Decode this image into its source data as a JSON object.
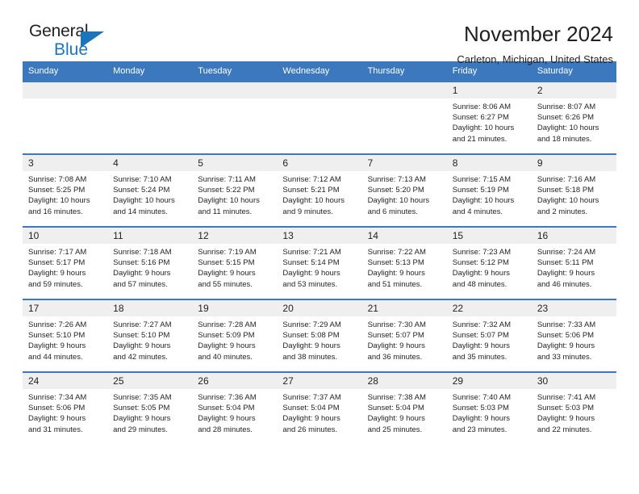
{
  "brand": {
    "name_part1": "General",
    "name_part2": "Blue",
    "accent_color": "#1b75bc",
    "header_color": "#3b78bd"
  },
  "header": {
    "title": "November 2024",
    "subtitle": "Carleton, Michigan, United States"
  },
  "calendar": {
    "weekday_headers": [
      "Sunday",
      "Monday",
      "Tuesday",
      "Wednesday",
      "Thursday",
      "Friday",
      "Saturday"
    ],
    "weeks": [
      [
        {
          "day": "",
          "lines": []
        },
        {
          "day": "",
          "lines": []
        },
        {
          "day": "",
          "lines": []
        },
        {
          "day": "",
          "lines": []
        },
        {
          "day": "",
          "lines": []
        },
        {
          "day": "1",
          "lines": [
            "Sunrise: 8:06 AM",
            "Sunset: 6:27 PM",
            "Daylight: 10 hours",
            "and 21 minutes."
          ]
        },
        {
          "day": "2",
          "lines": [
            "Sunrise: 8:07 AM",
            "Sunset: 6:26 PM",
            "Daylight: 10 hours",
            "and 18 minutes."
          ]
        }
      ],
      [
        {
          "day": "3",
          "lines": [
            "Sunrise: 7:08 AM",
            "Sunset: 5:25 PM",
            "Daylight: 10 hours",
            "and 16 minutes."
          ]
        },
        {
          "day": "4",
          "lines": [
            "Sunrise: 7:10 AM",
            "Sunset: 5:24 PM",
            "Daylight: 10 hours",
            "and 14 minutes."
          ]
        },
        {
          "day": "5",
          "lines": [
            "Sunrise: 7:11 AM",
            "Sunset: 5:22 PM",
            "Daylight: 10 hours",
            "and 11 minutes."
          ]
        },
        {
          "day": "6",
          "lines": [
            "Sunrise: 7:12 AM",
            "Sunset: 5:21 PM",
            "Daylight: 10 hours",
            "and 9 minutes."
          ]
        },
        {
          "day": "7",
          "lines": [
            "Sunrise: 7:13 AM",
            "Sunset: 5:20 PM",
            "Daylight: 10 hours",
            "and 6 minutes."
          ]
        },
        {
          "day": "8",
          "lines": [
            "Sunrise: 7:15 AM",
            "Sunset: 5:19 PM",
            "Daylight: 10 hours",
            "and 4 minutes."
          ]
        },
        {
          "day": "9",
          "lines": [
            "Sunrise: 7:16 AM",
            "Sunset: 5:18 PM",
            "Daylight: 10 hours",
            "and 2 minutes."
          ]
        }
      ],
      [
        {
          "day": "10",
          "lines": [
            "Sunrise: 7:17 AM",
            "Sunset: 5:17 PM",
            "Daylight: 9 hours",
            "and 59 minutes."
          ]
        },
        {
          "day": "11",
          "lines": [
            "Sunrise: 7:18 AM",
            "Sunset: 5:16 PM",
            "Daylight: 9 hours",
            "and 57 minutes."
          ]
        },
        {
          "day": "12",
          "lines": [
            "Sunrise: 7:19 AM",
            "Sunset: 5:15 PM",
            "Daylight: 9 hours",
            "and 55 minutes."
          ]
        },
        {
          "day": "13",
          "lines": [
            "Sunrise: 7:21 AM",
            "Sunset: 5:14 PM",
            "Daylight: 9 hours",
            "and 53 minutes."
          ]
        },
        {
          "day": "14",
          "lines": [
            "Sunrise: 7:22 AM",
            "Sunset: 5:13 PM",
            "Daylight: 9 hours",
            "and 51 minutes."
          ]
        },
        {
          "day": "15",
          "lines": [
            "Sunrise: 7:23 AM",
            "Sunset: 5:12 PM",
            "Daylight: 9 hours",
            "and 48 minutes."
          ]
        },
        {
          "day": "16",
          "lines": [
            "Sunrise: 7:24 AM",
            "Sunset: 5:11 PM",
            "Daylight: 9 hours",
            "and 46 minutes."
          ]
        }
      ],
      [
        {
          "day": "17",
          "lines": [
            "Sunrise: 7:26 AM",
            "Sunset: 5:10 PM",
            "Daylight: 9 hours",
            "and 44 minutes."
          ]
        },
        {
          "day": "18",
          "lines": [
            "Sunrise: 7:27 AM",
            "Sunset: 5:10 PM",
            "Daylight: 9 hours",
            "and 42 minutes."
          ]
        },
        {
          "day": "19",
          "lines": [
            "Sunrise: 7:28 AM",
            "Sunset: 5:09 PM",
            "Daylight: 9 hours",
            "and 40 minutes."
          ]
        },
        {
          "day": "20",
          "lines": [
            "Sunrise: 7:29 AM",
            "Sunset: 5:08 PM",
            "Daylight: 9 hours",
            "and 38 minutes."
          ]
        },
        {
          "day": "21",
          "lines": [
            "Sunrise: 7:30 AM",
            "Sunset: 5:07 PM",
            "Daylight: 9 hours",
            "and 36 minutes."
          ]
        },
        {
          "day": "22",
          "lines": [
            "Sunrise: 7:32 AM",
            "Sunset: 5:07 PM",
            "Daylight: 9 hours",
            "and 35 minutes."
          ]
        },
        {
          "day": "23",
          "lines": [
            "Sunrise: 7:33 AM",
            "Sunset: 5:06 PM",
            "Daylight: 9 hours",
            "and 33 minutes."
          ]
        }
      ],
      [
        {
          "day": "24",
          "lines": [
            "Sunrise: 7:34 AM",
            "Sunset: 5:06 PM",
            "Daylight: 9 hours",
            "and 31 minutes."
          ]
        },
        {
          "day": "25",
          "lines": [
            "Sunrise: 7:35 AM",
            "Sunset: 5:05 PM",
            "Daylight: 9 hours",
            "and 29 minutes."
          ]
        },
        {
          "day": "26",
          "lines": [
            "Sunrise: 7:36 AM",
            "Sunset: 5:04 PM",
            "Daylight: 9 hours",
            "and 28 minutes."
          ]
        },
        {
          "day": "27",
          "lines": [
            "Sunrise: 7:37 AM",
            "Sunset: 5:04 PM",
            "Daylight: 9 hours",
            "and 26 minutes."
          ]
        },
        {
          "day": "28",
          "lines": [
            "Sunrise: 7:38 AM",
            "Sunset: 5:04 PM",
            "Daylight: 9 hours",
            "and 25 minutes."
          ]
        },
        {
          "day": "29",
          "lines": [
            "Sunrise: 7:40 AM",
            "Sunset: 5:03 PM",
            "Daylight: 9 hours",
            "and 23 minutes."
          ]
        },
        {
          "day": "30",
          "lines": [
            "Sunrise: 7:41 AM",
            "Sunset: 5:03 PM",
            "Daylight: 9 hours",
            "and 22 minutes."
          ]
        }
      ]
    ]
  }
}
